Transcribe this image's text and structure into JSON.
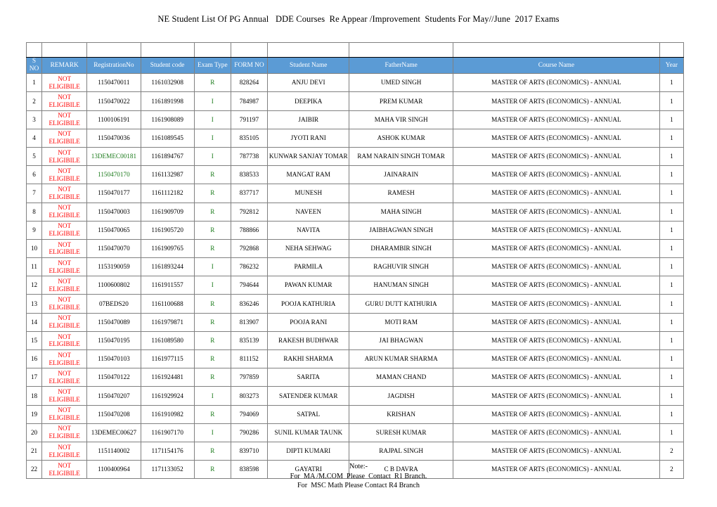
{
  "document": {
    "title": "NE Student List Of PG Annual   DDE Courses  Re Appear /Improvement  Students For May//June  2017 Exams"
  },
  "colors": {
    "header_bg": "#5B9BD5",
    "header_text": "#FFFFFF",
    "highlight_green": "#C6E0C6",
    "exam_text_green": "#1A7A1A",
    "remark_red": "#FF0000",
    "grid_line": "#808080"
  },
  "table": {
    "columns": [
      {
        "key": "sno",
        "label": "S NO"
      },
      {
        "key": "remark",
        "label": "REMARK"
      },
      {
        "key": "registration_no",
        "label": "RegistrationNo"
      },
      {
        "key": "student_code",
        "label": "Student code"
      },
      {
        "key": "exam_type",
        "label": "Exam Type"
      },
      {
        "key": "form_no",
        "label": "FORM NO"
      },
      {
        "key": "student_name",
        "label": "Student Name"
      },
      {
        "key": "father_name",
        "label": "FatherName"
      },
      {
        "key": "course_name",
        "label": "Course Name"
      },
      {
        "key": "year",
        "label": "Year"
      }
    ],
    "remark_line1": "NOT",
    "remark_line2": "ELIGIBILE",
    "rows": [
      {
        "sno": "1",
        "remark1": "NOT",
        "remark2": "ELIGIBILE",
        "registration_no": "1150470011",
        "reg_highlight": false,
        "student_code": "1161032908",
        "exam_type": "R",
        "form_no": "828264",
        "student_name": "ANJU DEVI",
        "father_name": "UMED SINGH",
        "course_name": "MASTER OF ARTS (ECONOMICS) - ANNUAL",
        "year": "1"
      },
      {
        "sno": "2",
        "remark1": "NOT",
        "remark2": "ELIGIBILE",
        "registration_no": "1150470022",
        "reg_highlight": false,
        "student_code": "1161891998",
        "exam_type": "I",
        "form_no": "784987",
        "student_name": "DEEPIKA",
        "father_name": "PREM KUMAR",
        "course_name": "MASTER OF ARTS (ECONOMICS) - ANNUAL",
        "year": "1"
      },
      {
        "sno": "3",
        "remark1": "NOT",
        "remark2": "ELIGIBILE",
        "registration_no": "1100106191",
        "reg_highlight": false,
        "student_code": "1161908089",
        "exam_type": "I",
        "form_no": "791197",
        "student_name": "JAIBIR",
        "father_name": "MAHA VIR SINGH",
        "course_name": "MASTER OF ARTS (ECONOMICS) - ANNUAL",
        "year": "1"
      },
      {
        "sno": "4",
        "remark1": "NOT",
        "remark2": "ELIGIBILE",
        "registration_no": "1150470036",
        "reg_highlight": false,
        "student_code": "1161089545",
        "exam_type": "I",
        "form_no": "835105",
        "student_name": "JYOTI RANI",
        "father_name": "ASHOK KUMAR",
        "course_name": "MASTER OF ARTS (ECONOMICS) - ANNUAL",
        "year": "1"
      },
      {
        "sno": "5",
        "remark1": "NOT",
        "remark2": "ELIGIBILE",
        "registration_no": "13DEMEC00181",
        "reg_highlight": true,
        "student_code": "1161894767",
        "exam_type": "I",
        "form_no": "787738",
        "student_name": "KUNWAR SANJAY TOMAR",
        "father_name": "RAM NARAIN SINGH TOMAR",
        "course_name": "MASTER OF ARTS (ECONOMICS) - ANNUAL",
        "year": "1"
      },
      {
        "sno": "6",
        "remark1": "NOT",
        "remark2": "ELIGIBILE",
        "registration_no": "1150470170",
        "reg_highlight": true,
        "student_code": "1161132987",
        "exam_type": "R",
        "form_no": "838533",
        "student_name": "MANGAT RAM",
        "father_name": "JAINARAIN",
        "course_name": "MASTER OF ARTS (ECONOMICS) - ANNUAL",
        "year": "1"
      },
      {
        "sno": "7",
        "remark1": "NOT",
        "remark2": "ELIGIBILE",
        "registration_no": "1150470177",
        "reg_highlight": false,
        "student_code": "1161112182",
        "exam_type": "R",
        "form_no": "837717",
        "student_name": "MUNESH",
        "father_name": "RAMESH",
        "course_name": "MASTER OF ARTS (ECONOMICS) - ANNUAL",
        "year": "1"
      },
      {
        "sno": "8",
        "remark1": "NOT",
        "remark2": "ELIGIBILE",
        "registration_no": "1150470003",
        "reg_highlight": false,
        "student_code": "1161909709",
        "exam_type": "R",
        "form_no": "792812",
        "student_name": "NAVEEN",
        "father_name": "MAHA SINGH",
        "course_name": "MASTER OF ARTS (ECONOMICS) - ANNUAL",
        "year": "1"
      },
      {
        "sno": "9",
        "remark1": "NOT",
        "remark2": "ELIGIBILE",
        "registration_no": "1150470065",
        "reg_highlight": false,
        "student_code": "1161905720",
        "exam_type": "R",
        "form_no": "788866",
        "student_name": "NAVITA",
        "father_name": "JAIBHAGWAN SINGH",
        "course_name": "MASTER OF ARTS (ECONOMICS) - ANNUAL",
        "year": "1"
      },
      {
        "sno": "10",
        "remark1": "NOT",
        "remark2": "ELIGIBILE",
        "registration_no": "1150470070",
        "reg_highlight": false,
        "student_code": "1161909765",
        "exam_type": "R",
        "form_no": "792868",
        "student_name": "NEHA SEHWAG",
        "father_name": "DHARAMBIR SINGH",
        "course_name": "MASTER OF ARTS (ECONOMICS) - ANNUAL",
        "year": "1"
      },
      {
        "sno": "11",
        "remark1": "NOT",
        "remark2": "ELIGIBILE",
        "registration_no": "1153190059",
        "reg_highlight": false,
        "student_code": "1161893244",
        "exam_type": "I",
        "form_no": "786232",
        "student_name": "PARMILA",
        "father_name": "RAGHUVIR SINGH",
        "course_name": "MASTER OF ARTS (ECONOMICS) - ANNUAL",
        "year": "1"
      },
      {
        "sno": "12",
        "remark1": "NOT",
        "remark2": "ELIGIBILE",
        "registration_no": "1100600802",
        "reg_highlight": false,
        "student_code": "1161911557",
        "exam_type": "I",
        "form_no": "794644",
        "student_name": "PAWAN KUMAR",
        "father_name": "HANUMAN SINGH",
        "course_name": "MASTER OF ARTS (ECONOMICS) - ANNUAL",
        "year": "1"
      },
      {
        "sno": "13",
        "remark1": "NOT",
        "remark2": "ELIGIBILE",
        "registration_no": "07BEDS20",
        "reg_highlight": false,
        "student_code": "1161100688",
        "exam_type": "R",
        "form_no": "836246",
        "student_name": "POOJA KATHURIA",
        "father_name": "GURU DUTT KATHURIA",
        "course_name": "MASTER OF ARTS (ECONOMICS) - ANNUAL",
        "year": "1"
      },
      {
        "sno": "14",
        "remark1": "NOT",
        "remark2": "ELIGIBILE",
        "registration_no": "1150470089",
        "reg_highlight": false,
        "student_code": "1161979871",
        "exam_type": "R",
        "form_no": "813907",
        "student_name": "POOJA RANI",
        "father_name": "MOTI RAM",
        "course_name": "MASTER OF ARTS (ECONOMICS) - ANNUAL",
        "year": "1"
      },
      {
        "sno": "15",
        "remark1": "NOT",
        "remark2": "ELIGIBILE",
        "registration_no": "1150470195",
        "reg_highlight": false,
        "student_code": "1161089580",
        "exam_type": "R",
        "form_no": "835139",
        "student_name": "RAKESH BUDHWAR",
        "father_name": "JAI BHAGWAN",
        "course_name": "MASTER OF ARTS (ECONOMICS) - ANNUAL",
        "year": "1"
      },
      {
        "sno": "16",
        "remark1": "NOT",
        "remark2": "ELIGIBILE",
        "registration_no": "1150470103",
        "reg_highlight": false,
        "student_code": "1161977115",
        "exam_type": "R",
        "form_no": "811152",
        "student_name": "RAKHI SHARMA",
        "father_name": "ARUN KUMAR SHARMA",
        "course_name": "MASTER OF ARTS (ECONOMICS) - ANNUAL",
        "year": "1"
      },
      {
        "sno": "17",
        "remark1": "NOT",
        "remark2": "ELIGIBILE",
        "registration_no": "1150470122",
        "reg_highlight": false,
        "student_code": "1161924481",
        "exam_type": "R",
        "form_no": "797859",
        "student_name": "SARITA",
        "father_name": "MAMAN CHAND",
        "course_name": "MASTER OF ARTS (ECONOMICS) - ANNUAL",
        "year": "1"
      },
      {
        "sno": "18",
        "remark1": "NOT",
        "remark2": "ELIGIBILE",
        "registration_no": "1150470207",
        "reg_highlight": false,
        "student_code": "1161929924",
        "exam_type": "I",
        "form_no": "803273",
        "student_name": "SATENDER KUMAR",
        "father_name": "JAGDISH",
        "course_name": "MASTER OF ARTS (ECONOMICS) - ANNUAL",
        "year": "1"
      },
      {
        "sno": "19",
        "remark1": "NOT",
        "remark2": "ELIGIBILE",
        "registration_no": "1150470208",
        "reg_highlight": false,
        "student_code": "1161910982",
        "exam_type": "R",
        "form_no": "794069",
        "student_name": "SATPAL",
        "father_name": "KRISHAN",
        "course_name": "MASTER OF ARTS (ECONOMICS) - ANNUAL",
        "year": "1"
      },
      {
        "sno": "20",
        "remark1": "NOT",
        "remark2": "ELIGIBILE",
        "registration_no": "13DEMEC00627",
        "reg_highlight": false,
        "student_code": "1161907170",
        "exam_type": "I",
        "form_no": "790286",
        "student_name": "SUNIL KUMAR TAUNK",
        "father_name": "SURESH KUMAR",
        "course_name": "MASTER OF ARTS (ECONOMICS) - ANNUAL",
        "year": "1"
      },
      {
        "sno": "21",
        "remark1": "NOT",
        "remark2": "ELIGIBILE",
        "registration_no": "1151140002",
        "reg_highlight": false,
        "student_code": "1171154176",
        "exam_type": "R",
        "form_no": "839710",
        "student_name": "DIPTI KUMARI",
        "father_name": "RAJPAL SINGH",
        "course_name": "MASTER OF ARTS (ECONOMICS) - ANNUAL",
        "year": "2"
      },
      {
        "sno": "22",
        "remark1": "NOT",
        "remark2": "ELIGIBILE",
        "registration_no": "1100400964",
        "reg_highlight": false,
        "student_code": "1171133052",
        "exam_type": "R",
        "form_no": "838598",
        "student_name": "GAYATRI",
        "father_name": "C B DAVRA",
        "course_name": "MASTER OF ARTS (ECONOMICS) - ANNUAL",
        "year": "2"
      }
    ]
  },
  "footer": {
    "line1": "Note:-",
    "line2": "For  MA /M.COM  Please  Contact  R1 Branch.",
    "line3": "For  MSC Math Please Contact R4 Branch"
  }
}
